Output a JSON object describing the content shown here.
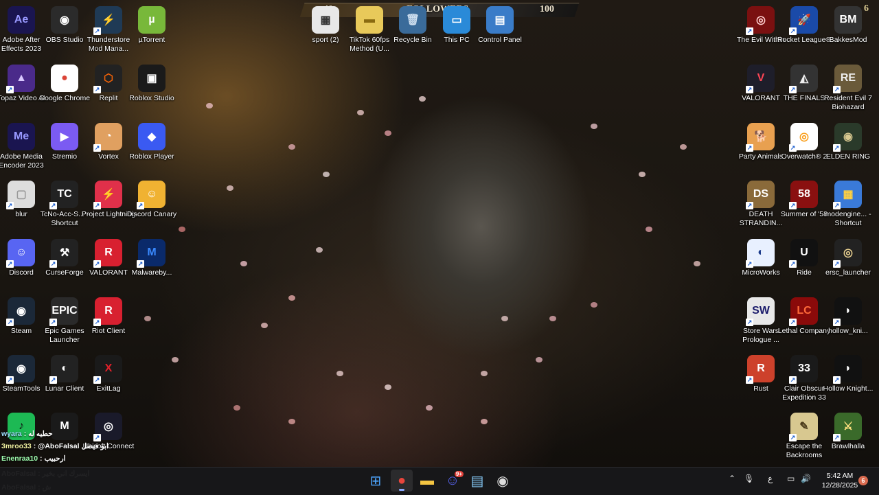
{
  "overlay": {
    "followers_label": "FOLLOWERS",
    "current": "40",
    "goal": "100",
    "progress": 0.4,
    "corner_number": "6"
  },
  "desktop": {
    "icons": [
      {
        "label": "Adobe After Effects 2023",
        "abbr": "Ae",
        "color": "#1a1550",
        "fg": "#9999ff",
        "shortcut": false
      },
      {
        "label": "OBS Studio",
        "abbr": "◉",
        "color": "#2b2b2b",
        "fg": "#ffffff",
        "shortcut": false
      },
      {
        "label": "Thunderstore Mod Mana...",
        "abbr": "⚡",
        "color": "#1f3a55",
        "fg": "#4fb2e8",
        "shortcut": true
      },
      {
        "label": "µTorrent",
        "abbr": "µ",
        "color": "#78b83a",
        "fg": "#ffffff",
        "shortcut": false
      },
      {
        "label": "sport (2)",
        "abbr": "▦",
        "color": "#e8e8e8",
        "fg": "#333333",
        "shortcut": false
      },
      {
        "label": "TikTok 60fps Method (U...",
        "abbr": "▬",
        "color": "#e8c95a",
        "fg": "#8a6a10",
        "shortcut": false
      },
      {
        "label": "Recycle Bin",
        "abbr": "🗑",
        "color": "#3a6b9a",
        "fg": "#cde",
        "shortcut": false
      },
      {
        "label": "This PC",
        "abbr": "▭",
        "color": "#2a8ad8",
        "fg": "#ffffff",
        "shortcut": false
      },
      {
        "label": "Control Panel",
        "abbr": "▤",
        "color": "#3a7cc8",
        "fg": "#ffffff",
        "shortcut": false
      },
      {
        "label": "The Evil Within",
        "abbr": "◎",
        "color": "#7a1010",
        "fg": "#ffd0d0",
        "shortcut": true
      },
      {
        "label": "Rocket League®",
        "abbr": "🚀",
        "color": "#1a4aa8",
        "fg": "#ffffff",
        "shortcut": true
      },
      {
        "label": "BakkesMod",
        "abbr": "BM",
        "color": "#333333",
        "fg": "#ffffff",
        "shortcut": false
      },
      {
        "label": "Topaz Video AI",
        "abbr": "▲",
        "color": "#4a2a8a",
        "fg": "#d9c8ff",
        "shortcut": true
      },
      {
        "label": "Google Chrome",
        "abbr": "●",
        "color": "#ffffff",
        "fg": "#db4437",
        "shortcut": false
      },
      {
        "label": "Replit",
        "abbr": "⬡",
        "color": "#222222",
        "fg": "#f26207",
        "shortcut": true
      },
      {
        "label": "Roblox Studio",
        "abbr": "▣",
        "color": "#1a1a1a",
        "fg": "#ffffff",
        "shortcut": false
      },
      {
        "label": "VALORANT",
        "abbr": "V",
        "color": "#1e1e2a",
        "fg": "#ff4655",
        "shortcut": true
      },
      {
        "label": "THE FINALS",
        "abbr": "◭",
        "color": "#333333",
        "fg": "#eeeeee",
        "shortcut": true
      },
      {
        "label": "Resident Evil 7 Biohazard",
        "abbr": "RE",
        "color": "#6a5a3a",
        "fg": "#eee",
        "shortcut": true
      },
      {
        "label": "Adobe Media Encoder 2023",
        "abbr": "Me",
        "color": "#1a1550",
        "fg": "#9999ff",
        "shortcut": false
      },
      {
        "label": "Stremio",
        "abbr": "▶",
        "color": "#7b5bf2",
        "fg": "#ffffff",
        "shortcut": false
      },
      {
        "label": "Vortex",
        "abbr": "◔",
        "color": "#e0a060",
        "fg": "#ffffff",
        "shortcut": true
      },
      {
        "label": "Roblox Player",
        "abbr": "◆",
        "color": "#3a5af2",
        "fg": "#ffffff",
        "shortcut": false
      },
      {
        "label": "Party Animals",
        "abbr": "🐕",
        "color": "#e8a050",
        "fg": "#ffffff",
        "shortcut": true
      },
      {
        "label": "Overwatch® 2",
        "abbr": "◎",
        "color": "#ffffff",
        "fg": "#f99e1a",
        "shortcut": true
      },
      {
        "label": "ELDEN RING",
        "abbr": "◉",
        "color": "#2a3a2a",
        "fg": "#d8c890",
        "shortcut": true
      },
      {
        "label": "blur",
        "abbr": "▢",
        "color": "#dddddd",
        "fg": "#999",
        "shortcut": true
      },
      {
        "label": "TcNo-Acc-S... - Shortcut",
        "abbr": "TC",
        "color": "#222222",
        "fg": "#ffffff",
        "shortcut": true
      },
      {
        "label": "Project Lightning",
        "abbr": "⚡",
        "color": "#e0304a",
        "fg": "#ffffff",
        "shortcut": true
      },
      {
        "label": "Discord Canary",
        "abbr": "☺",
        "color": "#f0b232",
        "fg": "#ffffff",
        "shortcut": true
      },
      {
        "label": "DEATH STRANDIN...",
        "abbr": "DS",
        "color": "#8a6a3a",
        "fg": "#ffffff",
        "shortcut": true
      },
      {
        "label": "Summer of '58",
        "abbr": "58",
        "color": "#8a1010",
        "fg": "#ffffff",
        "shortcut": true
      },
      {
        "label": "modengine... - Shortcut",
        "abbr": "▦",
        "color": "#3a7ad8",
        "fg": "#ffd040",
        "shortcut": true
      },
      {
        "label": "Discord",
        "abbr": "☺",
        "color": "#5865f2",
        "fg": "#ffffff",
        "shortcut": true
      },
      {
        "label": "CurseForge",
        "abbr": "⚒",
        "color": "#222222",
        "fg": "#ffffff",
        "shortcut": true
      },
      {
        "label": "VALORANT",
        "abbr": "R",
        "color": "#d82030",
        "fg": "#ffffff",
        "shortcut": true
      },
      {
        "label": "Malwareby...",
        "abbr": "M",
        "color": "#0a2a6a",
        "fg": "#3a8aff",
        "shortcut": true
      },
      {
        "label": "MicroWorks",
        "abbr": "◐",
        "color": "#e8f0ff",
        "fg": "#1a3a8a",
        "shortcut": true
      },
      {
        "label": "Ride",
        "abbr": "U",
        "color": "#111111",
        "fg": "#ffffff",
        "shortcut": true
      },
      {
        "label": "ersc_launcher",
        "abbr": "◎",
        "color": "#222222",
        "fg": "#e8d090",
        "shortcut": true
      },
      {
        "label": "Steam",
        "abbr": "◉",
        "color": "#1b2838",
        "fg": "#ffffff",
        "shortcut": true
      },
      {
        "label": "Epic Games Launcher",
        "abbr": "EPIC",
        "color": "#2a2a2a",
        "fg": "#ffffff",
        "shortcut": true
      },
      {
        "label": "Riot Client",
        "abbr": "R",
        "color": "#d82030",
        "fg": "#ffffff",
        "shortcut": true
      },
      {
        "label": "Store Wars Prologue ...",
        "abbr": "SW",
        "color": "#e8e8e8",
        "fg": "#1a1a6a",
        "shortcut": true
      },
      {
        "label": "Lethal Company",
        "abbr": "LC",
        "color": "#8a0a0a",
        "fg": "#ff6a3a",
        "shortcut": true
      },
      {
        "label": "hollow_kni...",
        "abbr": "◗",
        "color": "#111111",
        "fg": "#ffffff",
        "shortcut": true
      },
      {
        "label": "SteamTools",
        "abbr": "◉",
        "color": "#1b2838",
        "fg": "#ffffff",
        "shortcut": true
      },
      {
        "label": "Lunar Client",
        "abbr": "◐",
        "color": "#222222",
        "fg": "#ffffff",
        "shortcut": true
      },
      {
        "label": "ExitLag",
        "abbr": "X",
        "color": "#1a1a1a",
        "fg": "#e0202a",
        "shortcut": true
      },
      {
        "label": "Rust",
        "abbr": "R",
        "color": "#cd412b",
        "fg": "#ffffff",
        "shortcut": true
      },
      {
        "label": "Clair Obscur Expedition 33",
        "abbr": "33",
        "color": "#1a1a1a",
        "fg": "#ffffff",
        "shortcut": true
      },
      {
        "label": "Hollow Knight...",
        "abbr": "◗",
        "color": "#111111",
        "fg": "#ffffff",
        "shortcut": true
      },
      {
        "label": "",
        "abbr": "♪",
        "color": "#1db954",
        "fg": "#111111",
        "shortcut": false
      },
      {
        "label": "",
        "abbr": "M",
        "color": "#1a1a1a",
        "fg": "#ffffff",
        "shortcut": false
      },
      {
        "label": "Ubisoft Connect",
        "abbr": "◎",
        "color": "#1a1a2a",
        "fg": "#ffffff",
        "shortcut": true
      },
      {
        "label": "Escape the Backrooms",
        "abbr": "✎",
        "color": "#d8c890",
        "fg": "#4a3a1a",
        "shortcut": true
      },
      {
        "label": "Brawlhalla",
        "abbr": "⚔",
        "color": "#3a6a2a",
        "fg": "#ffe080",
        "shortcut": true
      }
    ]
  },
  "chat": [
    {
      "name": "wyara",
      "msg": ": حطيه له",
      "color": "#a0e0ff"
    },
    {
      "name": "3mroo33",
      "msg": ": @AboFalsal ابو فيصل",
      "color": "#f0f0a0"
    },
    {
      "name": "Enenraa10",
      "msg": ": ارحبيب",
      "color": "#a0ffb0"
    },
    {
      "name": "AboFalsal",
      "msg": ": ايسرك اني بخير",
      "color": "#ffffff"
    },
    {
      "name": "AboFalsal",
      "msg": ": ش",
      "color": "#ffffff"
    }
  ],
  "taskbar": {
    "apps": [
      {
        "name": "start-button",
        "glyph": "⊞",
        "color": "#4ea6ff"
      },
      {
        "name": "chrome-taskbar",
        "glyph": "●",
        "color": "#e8453c",
        "active": true
      },
      {
        "name": "file-explorer-taskbar",
        "glyph": "▬",
        "color": "#f4c542"
      },
      {
        "name": "discord-taskbar",
        "glyph": "☺",
        "color": "#5865f2",
        "badge": "9+"
      },
      {
        "name": "photos-taskbar",
        "glyph": "▤",
        "color": "#8ad0ff"
      },
      {
        "name": "recording-taskbar",
        "glyph": "◉",
        "color": "#dddddd"
      }
    ],
    "tray": {
      "chevron": "⌃",
      "mic": "🎙",
      "lang": "ع",
      "network": "▭",
      "volume": "🔊"
    },
    "time": "5:42 AM",
    "date": "12/28/2025",
    "notifications": "6",
    "chrome_color": "#e8453c",
    "discord_color": "#5865f2"
  }
}
